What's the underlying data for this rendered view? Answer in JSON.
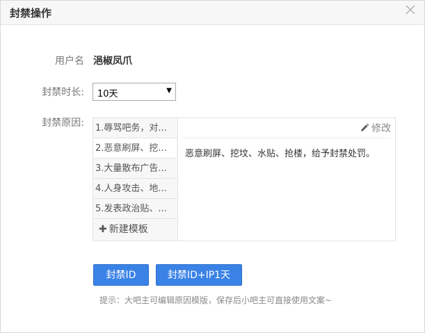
{
  "dialog": {
    "title": "封禁操作",
    "close_symbol": "╳"
  },
  "form": {
    "username_label": "用户名",
    "username_value": "浥椒凤爪",
    "duration_label": "封禁时长:",
    "duration_value": "10天",
    "reason_label": "封禁原因:"
  },
  "templates": {
    "items": [
      {
        "label": "1.辱骂吧务，对..."
      },
      {
        "label": "2.恶意刷屏、挖..."
      },
      {
        "label": "3.大量散布广告..."
      },
      {
        "label": "4.人身攻击、地..."
      },
      {
        "label": "5.发表政治贴、..."
      }
    ],
    "new_label": "新建模板",
    "edit_label": "修改",
    "reason_text": "恶意刷屏、挖坟、水贴、抢楼，给予封禁处罚。"
  },
  "actions": {
    "ban_id_label": "封禁ID",
    "ban_id_ip_label": "封禁ID+IP1天"
  },
  "hint": "提示：大吧主可编辑原因模版，保存后小吧主可直接使用文案~",
  "colors": {
    "primary_button": "#3a82e6",
    "header_bg": "#f7f7f7"
  },
  "icons": {
    "close": "close-icon",
    "edit": "pencil-icon",
    "add": "plus-icon",
    "dropdown": "caret-down-icon"
  }
}
